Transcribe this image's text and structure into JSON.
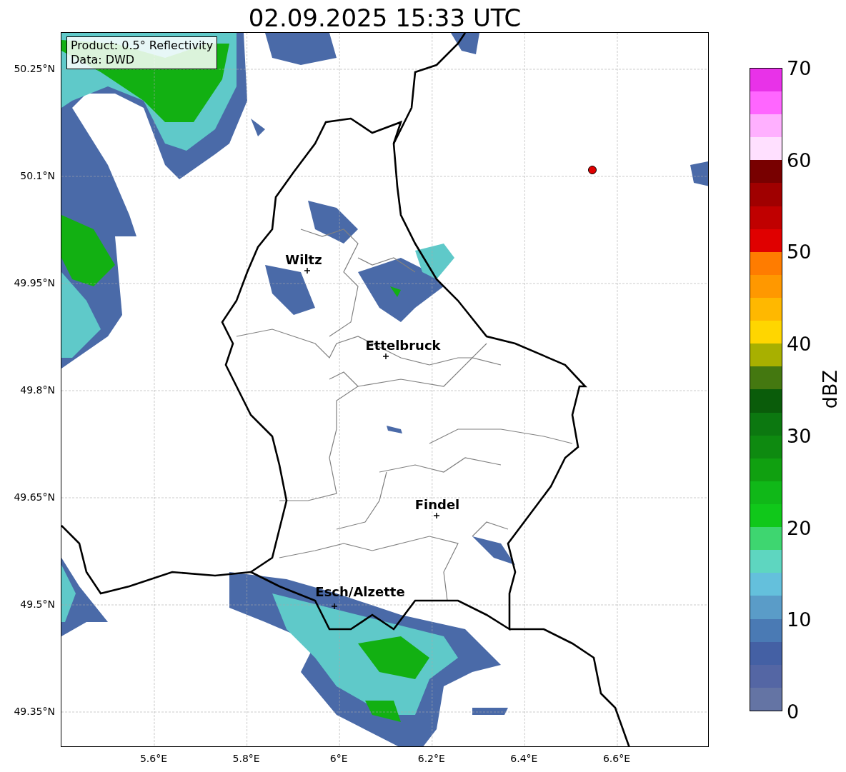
{
  "title": "02.09.2025 15:33 UTC",
  "legend": [
    "Product: 0.5° Reflectivity",
    "Data: DWD"
  ],
  "lat_ticks": [
    "50.25°N",
    "50.1°N",
    "49.95°N",
    "49.8°N",
    "49.65°N",
    "49.5°N",
    "49.35°N"
  ],
  "lon_ticks": [
    "5.6°E",
    "5.8°E",
    "6°E",
    "6.2°E",
    "6.4°E",
    "6.6°E"
  ],
  "cities": [
    {
      "name": "Wiltz"
    },
    {
      "name": "Ettelbruck"
    },
    {
      "name": "Findel"
    },
    {
      "name": "Esch/Alzette"
    }
  ],
  "colorbar": {
    "label": "dBZ",
    "ticks": [
      "70",
      "60",
      "50",
      "40",
      "30",
      "20",
      "10",
      "0"
    ],
    "segments": [
      {
        "color": "#6474a4"
      },
      {
        "color": "#5466a4"
      },
      {
        "color": "#4460a4"
      },
      {
        "color": "#4a7ab4"
      },
      {
        "color": "#5a9cc8"
      },
      {
        "color": "#64c0dc"
      },
      {
        "color": "#5ed6c0"
      },
      {
        "color": "#3ed670"
      },
      {
        "color": "#10c81a"
      },
      {
        "color": "#10b818"
      },
      {
        "color": "#10a010"
      },
      {
        "color": "#0e8a10"
      },
      {
        "color": "#0c7810"
      },
      {
        "color": "#0a5c0a"
      },
      {
        "color": "#447810"
      },
      {
        "color": "#a8b000"
      },
      {
        "color": "#ffd600"
      },
      {
        "color": "#ffb800"
      },
      {
        "color": "#ff9800"
      },
      {
        "color": "#ff7c00"
      },
      {
        "color": "#e00000"
      },
      {
        "color": "#c00000"
      },
      {
        "color": "#a00000"
      },
      {
        "color": "#780000"
      },
      {
        "color": "#ffe0ff"
      },
      {
        "color": "#ffb0ff"
      },
      {
        "color": "#ff66ff"
      },
      {
        "color": "#e832e8"
      }
    ]
  }
}
